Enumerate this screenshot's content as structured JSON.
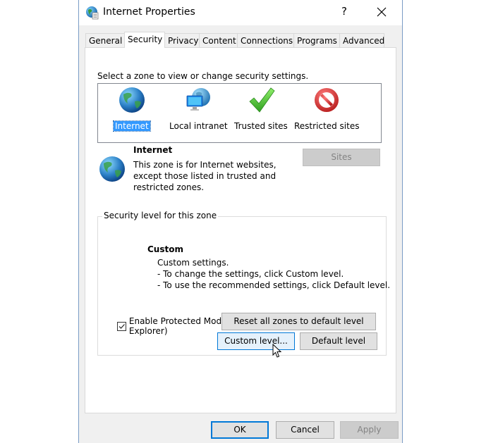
{
  "window": {
    "title": "Internet Properties",
    "help_glyph": "?",
    "close_glyph": "✕"
  },
  "tabs": [
    {
      "label": "General",
      "active": false
    },
    {
      "label": "Security",
      "active": true
    },
    {
      "label": "Privacy",
      "active": false
    },
    {
      "label": "Content",
      "active": false
    },
    {
      "label": "Connections",
      "active": false
    },
    {
      "label": "Programs",
      "active": false
    },
    {
      "label": "Advanced",
      "active": false
    }
  ],
  "security": {
    "zone_prompt": "Select a zone to view or change security settings.",
    "zones": [
      {
        "label": "Internet",
        "icon": "globe-icon",
        "selected": true
      },
      {
        "label": "Local intranet",
        "icon": "intranet-icon",
        "selected": false
      },
      {
        "label": "Trusted sites",
        "icon": "checkmark-icon",
        "selected": false
      },
      {
        "label": "Restricted sites",
        "icon": "prohibited-icon",
        "selected": false
      }
    ],
    "zone_info": {
      "name": "Internet",
      "description": "This zone is for Internet websites, except those listed in trusted and restricted zones."
    },
    "sites_button": "Sites",
    "level_group_title": "Security level for this zone",
    "level": {
      "name": "Custom",
      "description": "Custom settings.\n- To change the settings, click Custom level.\n- To use the recommended settings, click Default level."
    },
    "protected_mode": {
      "label": "Enable Protected Mode (requires restarting Internet Explorer)",
      "checked": true
    },
    "custom_level_button": "Custom level...",
    "default_level_button": "Default level",
    "reset_all_button": "Reset all zones to default level"
  },
  "footer": {
    "ok": "OK",
    "cancel": "Cancel",
    "apply": "Apply"
  },
  "colors": {
    "selection": "#3399ff",
    "focus_border": "#0078d7",
    "disabled_bg": "#cccccc"
  }
}
